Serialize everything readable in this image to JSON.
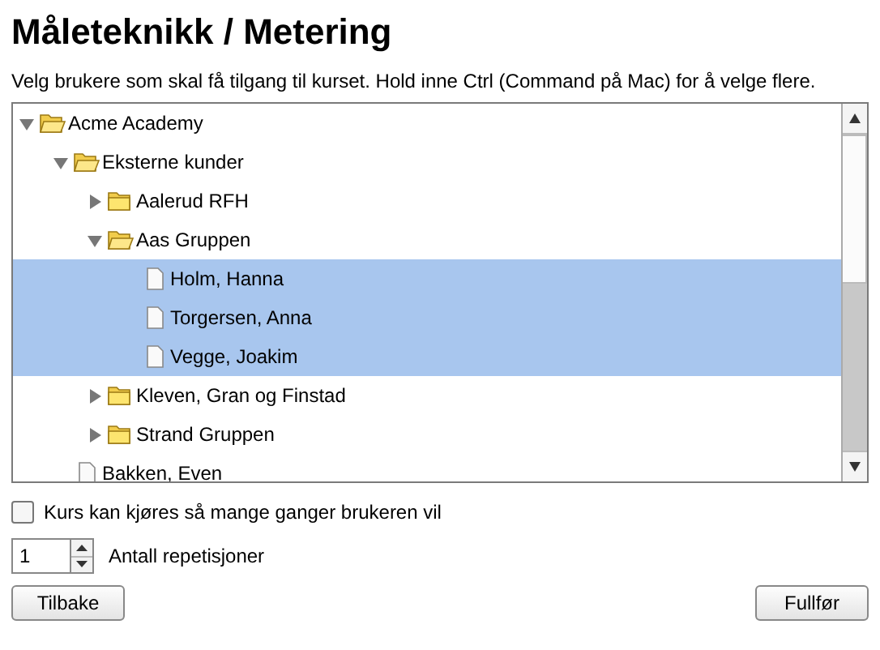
{
  "title": "Måleteknikk / Metering",
  "instructions": "Velg brukere som skal få tilgang til kurset. Hold inne Ctrl (Command på Mac) for å velge flere.",
  "tree": [
    {
      "kind": "folder",
      "label": "Acme Academy",
      "expanded": true,
      "selected": false,
      "children": [
        {
          "kind": "folder",
          "label": "Eksterne kunder",
          "expanded": true,
          "selected": false,
          "children": [
            {
              "kind": "folder",
              "label": "Aalerud RFH",
              "expanded": false,
              "selected": false
            },
            {
              "kind": "folder",
              "label": "Aas Gruppen",
              "expanded": true,
              "selected": false,
              "children": [
                {
                  "kind": "user",
                  "label": "Holm, Hanna",
                  "selected": true
                },
                {
                  "kind": "user",
                  "label": "Torgersen, Anna",
                  "selected": true
                },
                {
                  "kind": "user",
                  "label": "Vegge, Joakim",
                  "selected": true
                }
              ]
            },
            {
              "kind": "folder",
              "label": "Kleven, Gran og Finstad",
              "expanded": false,
              "selected": false
            },
            {
              "kind": "folder",
              "label": "Strand Gruppen",
              "expanded": false,
              "selected": false
            }
          ]
        },
        {
          "kind": "user",
          "label": "Bakken, Even",
          "selected": false
        }
      ]
    }
  ],
  "unlimited": {
    "label": "Kurs kan kjøres så mange ganger brukeren vil",
    "checked": false
  },
  "repetitions": {
    "value": "1",
    "label": "Antall repetisjoner"
  },
  "buttons": {
    "back": "Tilbake",
    "finish": "Fullfør"
  }
}
